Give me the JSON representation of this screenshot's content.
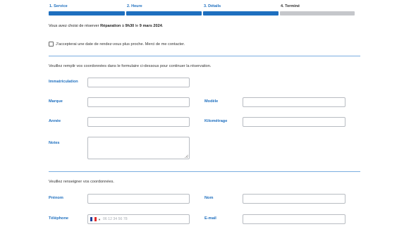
{
  "steps": [
    {
      "label": "1. Service",
      "state": "done"
    },
    {
      "label": "2. Heure",
      "state": "done"
    },
    {
      "label": "3. Détails",
      "state": "done"
    },
    {
      "label": "4. Terminé",
      "state": "pending"
    }
  ],
  "summary": {
    "prefix": "Vous avez choisi de réserver",
    "service": "Réparation",
    "at": "à",
    "time": "9h30",
    "on": "le",
    "date": "9 mars 2024",
    "end": "."
  },
  "alternate_date_checkbox": {
    "label": "J'accepterai une date de rendez-vous plus proche. Merci de me contacter.",
    "checked": false
  },
  "vehicle_intro": "Veuillez remplir vos coordonnées dans le formulaire ci-dessous pour continuer la réservation.",
  "vehicle_fields": {
    "immatriculation": {
      "label": "Immatriculation",
      "value": ""
    },
    "marque": {
      "label": "Marque",
      "value": ""
    },
    "modele": {
      "label": "Modèle",
      "value": ""
    },
    "annee": {
      "label": "Année",
      "value": ""
    },
    "kilometrage": {
      "label": "Kilométrage",
      "value": ""
    },
    "notes": {
      "label": "Notes",
      "value": ""
    }
  },
  "contact_intro": "Veuillez renseigner vos coordonnées.",
  "contact_fields": {
    "prenom": {
      "label": "Prénom",
      "value": ""
    },
    "nom": {
      "label": "Nom",
      "value": ""
    },
    "telephone": {
      "label": "Téléphone",
      "placeholder": "06 12 34 56 78",
      "country_icon": "france-flag-icon"
    },
    "email": {
      "label": "E-mail",
      "value": ""
    }
  },
  "colors": {
    "accent": "#1e6fbf",
    "inactive": "#c5c7cb",
    "divider": "#7aaee0"
  }
}
